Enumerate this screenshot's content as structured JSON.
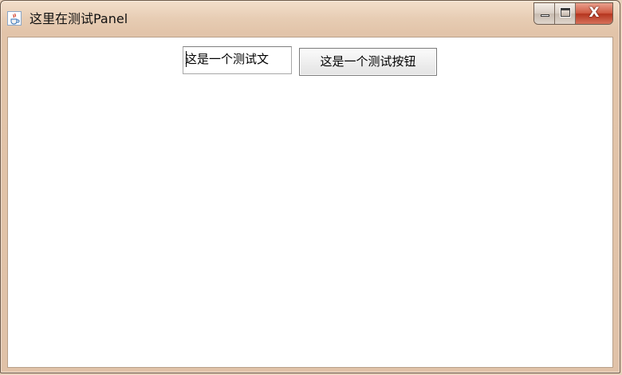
{
  "window": {
    "title": "这里在测试Panel",
    "icon": "java-cup-icon",
    "controls": {
      "minimize": "minimize-icon",
      "maximize": "maximize-icon",
      "close_label": "X"
    }
  },
  "panel": {
    "text_field_value": "这是一个测试文",
    "button_label": "这是一个测试按钮"
  },
  "colors": {
    "frame": "#e7cdb4",
    "content_background": "#ffffff",
    "close_button": "#c7452f"
  }
}
